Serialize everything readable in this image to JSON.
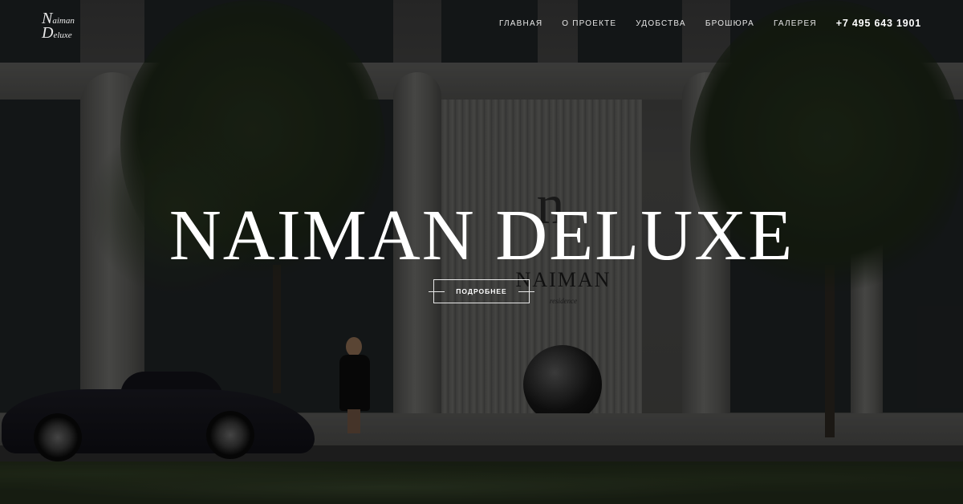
{
  "logo": {
    "line1_cap": "N",
    "line1_rest": "aiman",
    "line2_cap": "D",
    "line2_rest": "eluxe"
  },
  "nav": {
    "items": [
      {
        "label": "ГЛАВНАЯ"
      },
      {
        "label": "О ПРОЕКТЕ"
      },
      {
        "label": "УДОБСТВА"
      },
      {
        "label": "БРОШЮРА"
      },
      {
        "label": "ГАЛЕРЕЯ"
      }
    ],
    "phone": "+7 495 643 1901"
  },
  "hero": {
    "title": "NAIMAN DELUXE",
    "cta_label": "ПОДРОБНЕЕ"
  },
  "scene": {
    "sign_mark": "n",
    "sign_text": "NAIMAN",
    "sign_sub": "residence"
  },
  "colors": {
    "text": "#ffffff",
    "overlay": "rgba(0,0,0,0.35)"
  }
}
